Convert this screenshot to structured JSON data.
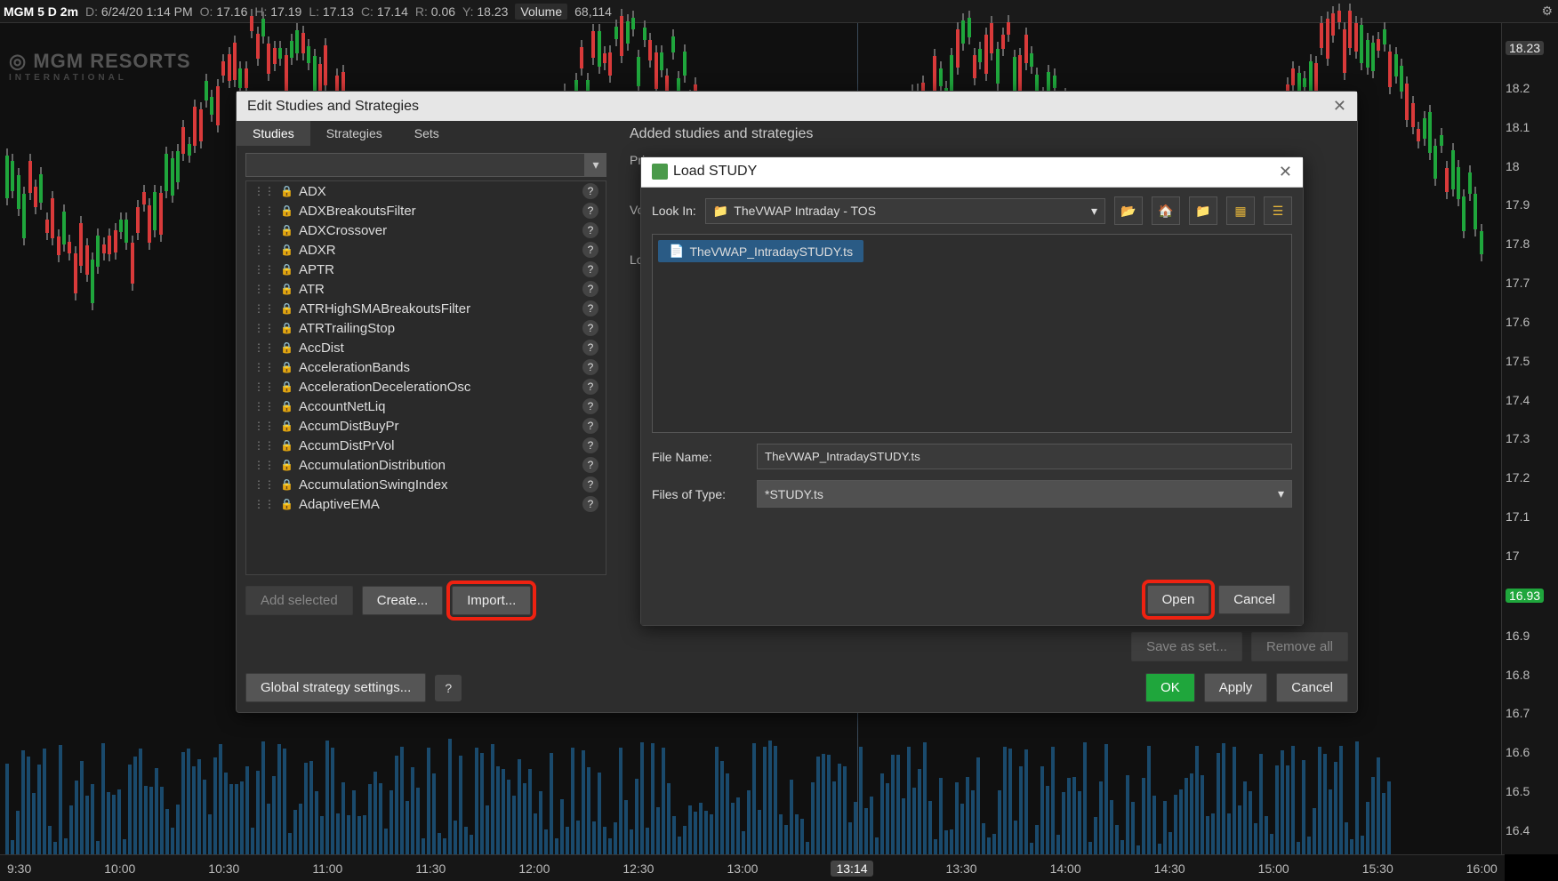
{
  "topbar": {
    "symbol": "MGM 5 D 2m",
    "date_label": "D:",
    "date": "6/24/20 1:14 PM",
    "o_label": "O:",
    "o": "17.16",
    "h_label": "H:",
    "h": "17.19",
    "l_label": "L:",
    "l": "17.13",
    "c_label": "C:",
    "c": "17.14",
    "r_label": "R:",
    "r": "0.06",
    "y_label": "Y:",
    "y": "18.23",
    "vol_label": "Volume",
    "vol": "68,114"
  },
  "logo": {
    "title": "MGM RESORTS",
    "sub": "INTERNATIONAL"
  },
  "price_ticks": [
    "18.23",
    "18.2",
    "18.1",
    "18",
    "17.9",
    "17.8",
    "17.7",
    "17.6",
    "17.5",
    "17.4",
    "17.3",
    "17.2",
    "17.1",
    "17",
    "16.93",
    "16.9",
    "16.8",
    "16.7",
    "16.6",
    "16.5",
    "16.4"
  ],
  "time_ticks": [
    "9:30",
    "10:00",
    "10:30",
    "11:00",
    "11:30",
    "12:00",
    "12:30",
    "13:00",
    "13:14",
    "13:30",
    "14:00",
    "14:30",
    "15:00",
    "15:30",
    "16:00"
  ],
  "edit_dialog": {
    "title": "Edit Studies and Strategies",
    "tabs": [
      "Studies",
      "Strategies",
      "Sets"
    ],
    "right_head": "Added studies and strategies",
    "sections": [
      "Pric",
      "Vol",
      "Low"
    ],
    "studies": [
      "ADX",
      "ADXBreakoutsFilter",
      "ADXCrossover",
      "ADXR",
      "APTR",
      "ATR",
      "ATRHighSMABreakoutsFilter",
      "ATRTrailingStop",
      "AccDist",
      "AccelerationBands",
      "AccelerationDecelerationOsc",
      "AccountNetLiq",
      "AccumDistBuyPr",
      "AccumDistPrVol",
      "AccumulationDistribution",
      "AccumulationSwingIndex",
      "AdaptiveEMA"
    ],
    "btn_add": "Add selected",
    "btn_create": "Create...",
    "btn_import": "Import...",
    "btn_saveset": "Save as set...",
    "btn_removeall": "Remove all",
    "btn_global": "Global strategy settings...",
    "btn_ok": "OK",
    "btn_apply": "Apply",
    "btn_cancel": "Cancel"
  },
  "load_dialog": {
    "title": "Load STUDY",
    "lookin_label": "Look In:",
    "lookin_value": "TheVWAP Intraday - TOS",
    "file_selected": "TheVWAP_IntradaySTUDY.ts",
    "filename_label": "File Name:",
    "filename_value": "TheVWAP_IntradaySTUDY.ts",
    "filetype_label": "Files of Type:",
    "filetype_value": "*STUDY.ts",
    "btn_open": "Open",
    "btn_cancel": "Cancel"
  }
}
